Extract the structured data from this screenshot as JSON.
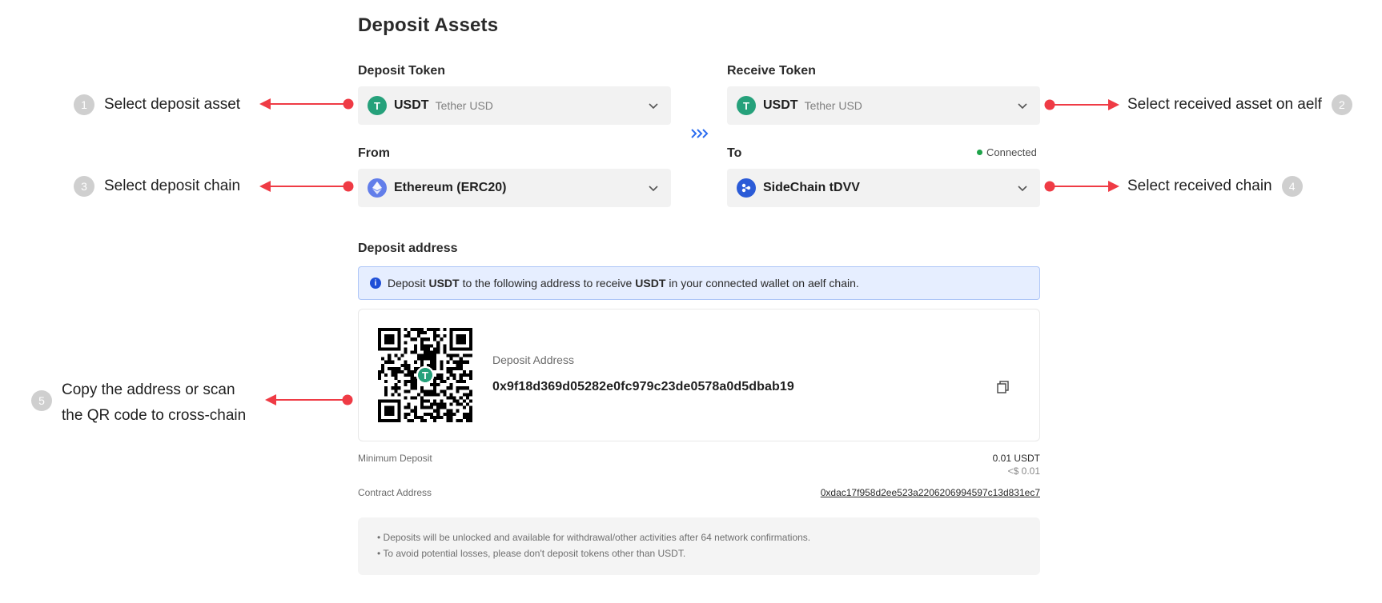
{
  "page": {
    "title": "Deposit Assets"
  },
  "deposit_token": {
    "label": "Deposit Token",
    "symbol": "USDT",
    "name": "Tether USD",
    "icon": "usdt-icon",
    "icon_glyph": "T"
  },
  "receive_token": {
    "label": "Receive Token",
    "symbol": "USDT",
    "name": "Tether USD",
    "icon": "usdt-icon",
    "icon_glyph": "T"
  },
  "from": {
    "label": "From",
    "chain": "Ethereum (ERC20)",
    "icon": "ethereum-icon"
  },
  "to": {
    "label": "To",
    "chain": "SideChain tDVV",
    "icon": "aelf-icon",
    "status": "Connected",
    "status_color": "#1fa34a"
  },
  "swap_icon": "double-chevron-right-icon",
  "deposit_address_section": {
    "label": "Deposit address",
    "info": {
      "prefix": "Deposit",
      "token1": "USDT",
      "middle": "to the following address to receive",
      "token2": "USDT",
      "suffix": "in your connected wallet on aelf chain."
    },
    "card": {
      "address_label": "Deposit Address",
      "address": "0x9f18d369d05282e0fc979c23de0578a0d5dbab19",
      "qr_center_glyph": "T"
    }
  },
  "minimum_deposit": {
    "label": "Minimum Deposit",
    "value": "0.01 USDT",
    "usd": "<$ 0.01"
  },
  "contract_address": {
    "label": "Contract Address",
    "value": "0xdac17f958d2ee523a2206206994597c13d831ec7"
  },
  "notes": [
    "• Deposits will be unlocked and available for withdrawal/other activities after 64 network confirmations.",
    "• To avoid potential losses, please don't deposit tokens other than USDT."
  ],
  "annotations": [
    {
      "number": "1",
      "text": "Select deposit asset"
    },
    {
      "number": "2",
      "text": "Select received asset on aelf"
    },
    {
      "number": "3",
      "text": "Select deposit chain"
    },
    {
      "number": "4",
      "text": "Select received chain"
    },
    {
      "number": "5",
      "line1": "Copy the address or scan",
      "line2": "the QR code to cross-chain"
    }
  ],
  "colors": {
    "annotation_arrow": "#ef3b45",
    "accent_blue": "#2b5bd7",
    "usdt_green": "#26a17b",
    "info_bg": "#e6eeff"
  }
}
